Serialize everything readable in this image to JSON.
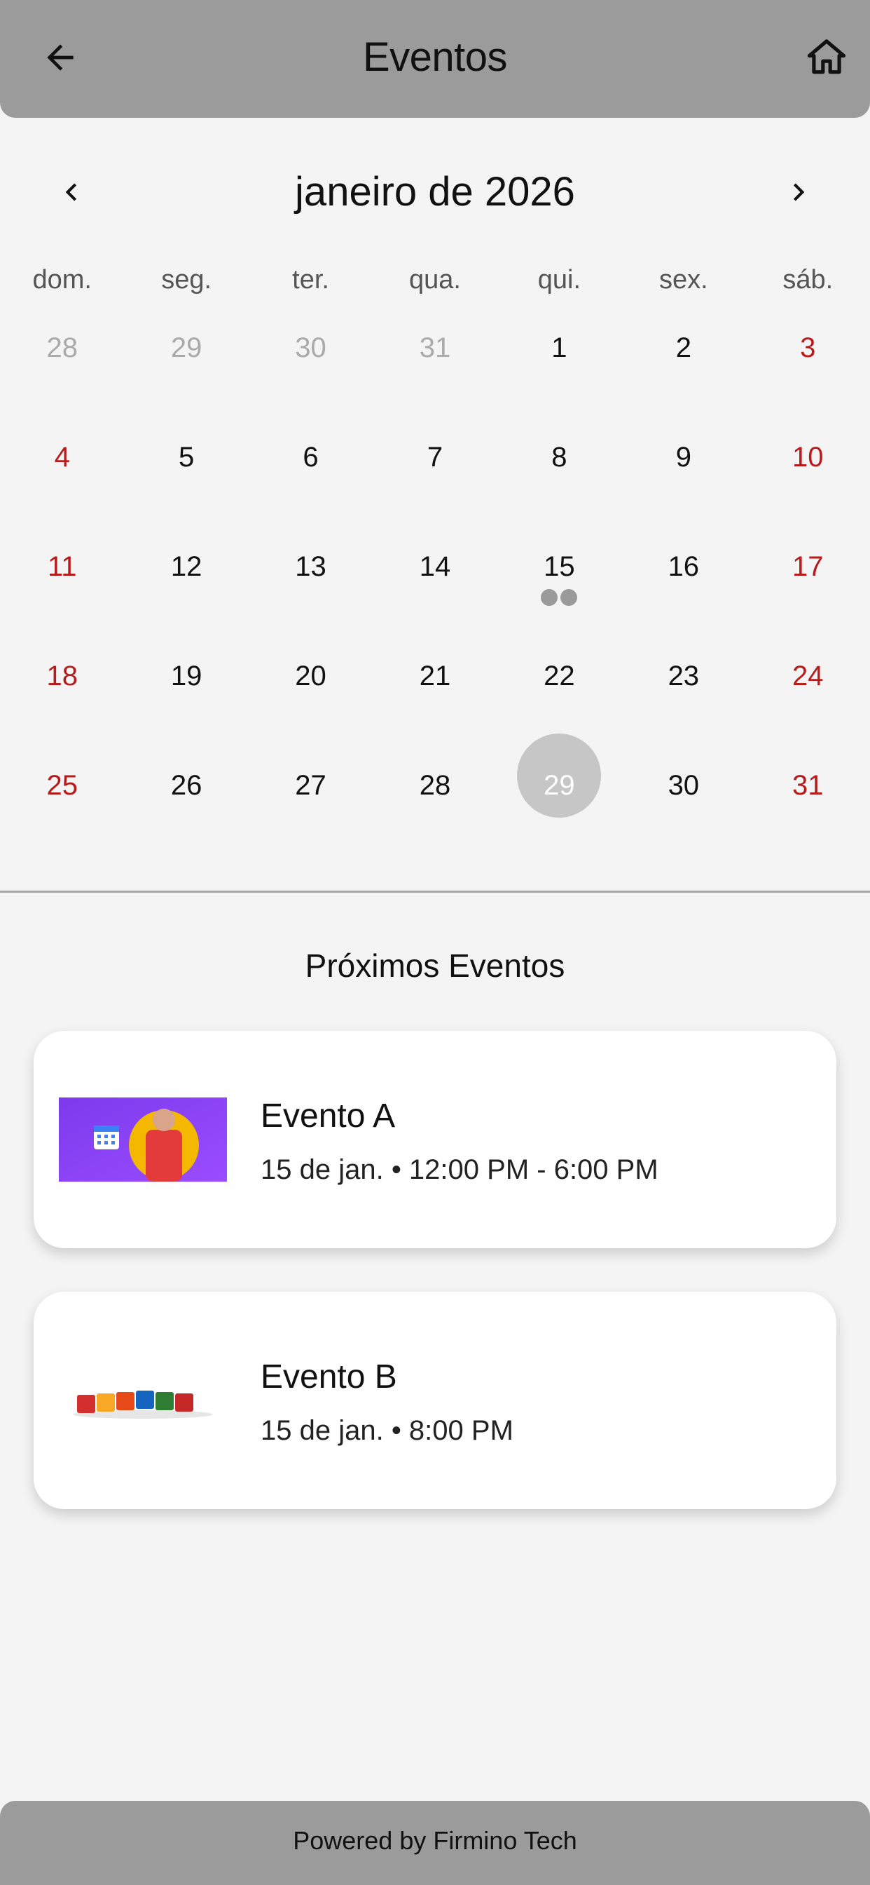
{
  "appbar": {
    "title": "Eventos",
    "back_icon": "arrow-left-icon",
    "home_icon": "home-icon"
  },
  "calendar": {
    "month_label": "janeiro de 2026",
    "weekdays": [
      "dom.",
      "seg.",
      "ter.",
      "qua.",
      "qui.",
      "sex.",
      "sáb."
    ],
    "weeks": [
      [
        "28",
        "29",
        "30",
        "31",
        "1",
        "2",
        "3"
      ],
      [
        "4",
        "5",
        "6",
        "7",
        "8",
        "9",
        "10"
      ],
      [
        "11",
        "12",
        "13",
        "14",
        "15",
        "16",
        "17"
      ],
      [
        "18",
        "19",
        "20",
        "21",
        "22",
        "23",
        "24"
      ],
      [
        "25",
        "26",
        "27",
        "28",
        "29",
        "30",
        "31"
      ]
    ],
    "selected_day": "29",
    "event_day": "15",
    "event_dot_count": 2,
    "colors": {
      "weekend": "#b71c1c",
      "muted": "#aaaaaa",
      "selected_bg": "#c6c6c6",
      "dot": "#9a9a9a"
    }
  },
  "events_section": {
    "title": "Próximos Eventos",
    "events": [
      {
        "title": "Evento A",
        "time": "15 de jan. • 12:00 PM - 6:00 PM"
      },
      {
        "title": "Evento B",
        "time": "15 de jan. • 8:00 PM"
      }
    ]
  },
  "footer": {
    "text": "Powered by Firmino Tech"
  }
}
